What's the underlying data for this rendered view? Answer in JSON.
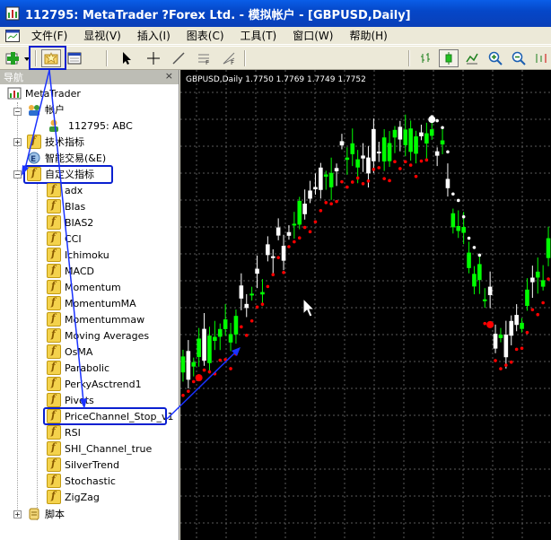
{
  "window": {
    "title": "112795: MetaTrader ?Forex Ltd. - 模拟帐户 - [GBPUSD,Daily]"
  },
  "menu": {
    "items": [
      "文件(F)",
      "显视(V)",
      "插入(I)",
      "图表(C)",
      "工具(T)",
      "窗口(W)",
      "帮助(H)"
    ]
  },
  "navigator": {
    "title": "导航",
    "close": "×",
    "root": "MetaTrader",
    "accounts_label": "帐户",
    "account_item": "112795: ABC",
    "tech_indicators": "技术指标",
    "expert_advisors": "智能交易(&E)",
    "custom_indicators": "自定义指标",
    "indicators": [
      "adx",
      "BIas",
      "BIAS2",
      "CCI",
      "Ichimoku",
      "MACD",
      "Momentum",
      "MomentumMA",
      "Momentummaw",
      "Moving Averages",
      "OsMA",
      "Parabolic",
      "PerkyAsctrend1",
      "Pivots",
      "PriceChannel_Stop_v1",
      "RSI",
      "SHI_Channel_true",
      "SilverTrend",
      "Stochastic",
      "ZigZag"
    ],
    "scripts": "脚本"
  },
  "chart": {
    "caption": "GBPUSD,Daily  1.7750 1.7769 1.7749 1.7752",
    "colors": {
      "background": "#000000",
      "bull": "#00ff00",
      "bear": "#ffffff",
      "stop_down": "#ff0000",
      "stop_up": "#ffffff",
      "grid": "#5a5a5a",
      "annotation": "#1a32ff"
    }
  }
}
